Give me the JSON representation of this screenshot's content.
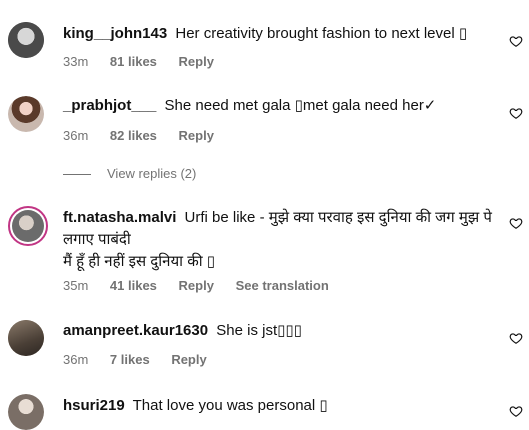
{
  "comments": [
    {
      "username": "king__john143",
      "text": "Her creativity brought fashion to next level ▯",
      "time": "33m",
      "likes": "81 likes",
      "reply": "Reply"
    },
    {
      "username": "_prabhjot___",
      "text": "She need met gala ▯met gala need her✓",
      "time": "36m",
      "likes": "82 likes",
      "reply": "Reply",
      "view_replies": "View replies (2)"
    },
    {
      "username": "ft.natasha.malvi",
      "text": "Urfi be like - मुझे क्या परवाह इस दुनिया की जग मुझ पे लगाए पाबंदी",
      "text2": "मैं हूँ ही नहीं इस दुनिया की ▯",
      "time": "35m",
      "likes": "41 likes",
      "reply": "Reply",
      "see_translation": "See translation"
    },
    {
      "username": "amanpreet.kaur1630",
      "text": "She is jst▯▯▯",
      "time": "36m",
      "likes": "7 likes",
      "reply": "Reply"
    },
    {
      "username": "hsuri219",
      "text": "That love you was personal ▯"
    }
  ],
  "icons": {
    "like": "heart-outline-icon"
  },
  "colors": {
    "muted": "#737373",
    "story_ring": "#c13584"
  }
}
